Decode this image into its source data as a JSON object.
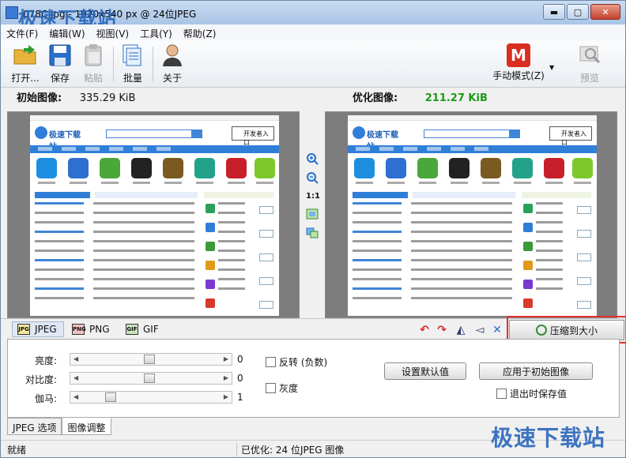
{
  "window": {
    "title": "078C.jpg - 1920x540 px @ 24位JPEG",
    "watermark_top": "极速下载站",
    "watermark_bottom": "极速下载站",
    "controls": {
      "minimize": "▬",
      "maximize": "▢",
      "close": "✕"
    }
  },
  "menu": [
    "文件(F)",
    "编辑(W)",
    "视图(V)",
    "工具(Y)",
    "帮助(Z)"
  ],
  "toolbar": {
    "open": "打开...",
    "save": "保存",
    "paste": "粘贴",
    "batch": "批量",
    "about": "关于",
    "mode_icon": "M",
    "mode": "手动模式(Z)",
    "preview": "预览"
  },
  "original": {
    "label": "初始图像:",
    "size": "335.29 KiB"
  },
  "optimized": {
    "label": "优化图像:",
    "size": "211.27 KiB",
    "size_color": "#1a9a1a"
  },
  "screenshot_preview": {
    "logo": "极速下载站",
    "dev_entry": "开发者入口"
  },
  "zoom": {
    "one_to_one": "1:1"
  },
  "formats": [
    {
      "name": "JPEG",
      "icon": "JPG"
    },
    {
      "name": "PNG",
      "icon": "PNG"
    },
    {
      "name": "GIF",
      "icon": "GIF"
    }
  ],
  "compress_button": "压缩到大小",
  "adjust": {
    "brightness": {
      "label": "亮度:",
      "value": "0",
      "level": 0.5
    },
    "contrast": {
      "label": "对比度:",
      "value": "0",
      "level": 0.5
    },
    "gamma": {
      "label": "伽马:",
      "value": "1",
      "level": 0.2
    },
    "invert": "反转 (负数)",
    "grayscale": "灰度",
    "set_default": "设置默认值",
    "apply_original": "应用于初始图像",
    "save_on_exit": "退出时保存值"
  },
  "tabs": [
    "JPEG 选项",
    "图像调整"
  ],
  "status": {
    "left": "就绪",
    "right": "已优化: 24 位JPEG 图像"
  }
}
